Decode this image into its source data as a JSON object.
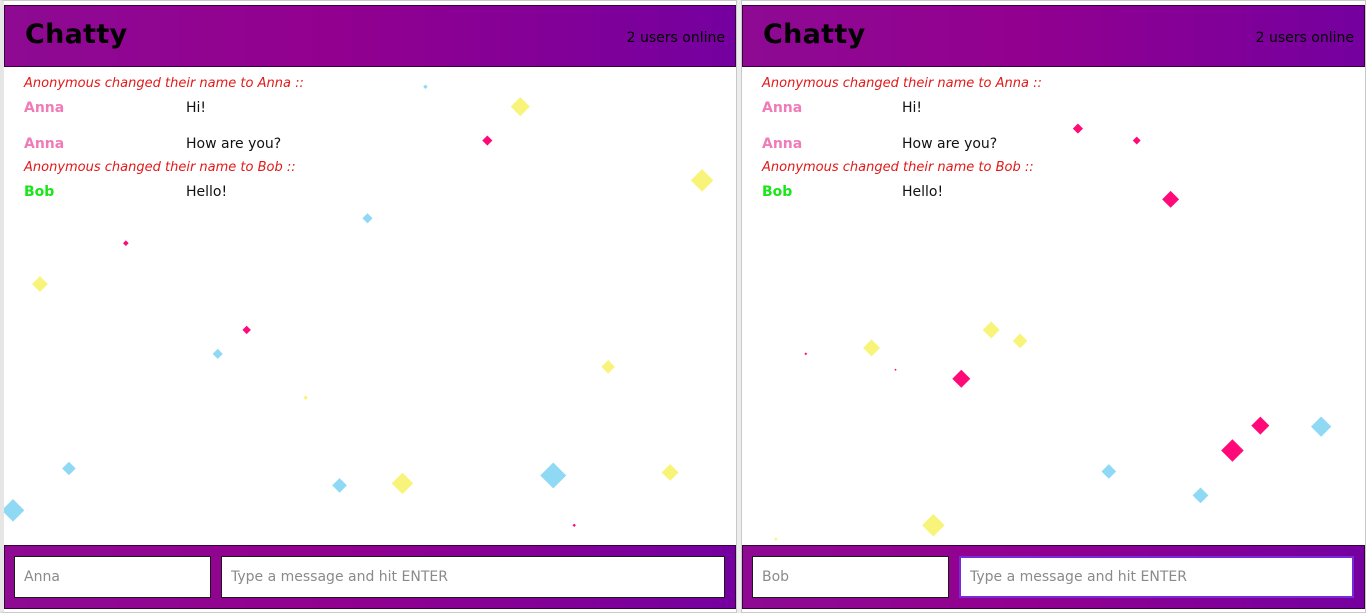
{
  "colors": {
    "header_gradient_start": "#8e0a93",
    "header_gradient_end": "#75009f",
    "system_text": "#e21919",
    "confetti_pink": "#ff0a78",
    "confetti_yellow": "#f8f47a",
    "confetti_blue": "#8fd9f5"
  },
  "panes": [
    {
      "brand": "Chatty",
      "users_online": "2 users online",
      "name_placeholder": "Anna",
      "message_placeholder": "Type a message and hit ENTER",
      "messages": [
        {
          "type": "system",
          "text": "Anonymous changed their name to Anna ::"
        },
        {
          "type": "message",
          "user": "Anna",
          "user_color": "#f17bb8",
          "content": "Hi!"
        },
        {
          "type": "message",
          "user": "Anna",
          "user_color": "#f17bb8",
          "content": "How are you?"
        },
        {
          "type": "system",
          "text": "Anonymous changed their name to Bob ::"
        },
        {
          "type": "message",
          "user": "Bob",
          "user_color": "#19e619",
          "content": "Hello!"
        }
      ]
    },
    {
      "brand": "Chatty",
      "users_online": "2 users online",
      "name_placeholder": "Bob",
      "message_placeholder": "Type a message and hit ENTER",
      "messages": [
        {
          "type": "system",
          "text": "Anonymous changed their name to Anna ::"
        },
        {
          "type": "message",
          "user": "Anna",
          "user_color": "#f17bb8",
          "content": "Hi!"
        },
        {
          "type": "message",
          "user": "Anna",
          "user_color": "#f17bb8",
          "content": "How are you?"
        },
        {
          "type": "system",
          "text": "Anonymous changed their name to Bob ::"
        },
        {
          "type": "message",
          "user": "Bob",
          "user_color": "#19e619",
          "content": "Hello!"
        }
      ]
    }
  ]
}
